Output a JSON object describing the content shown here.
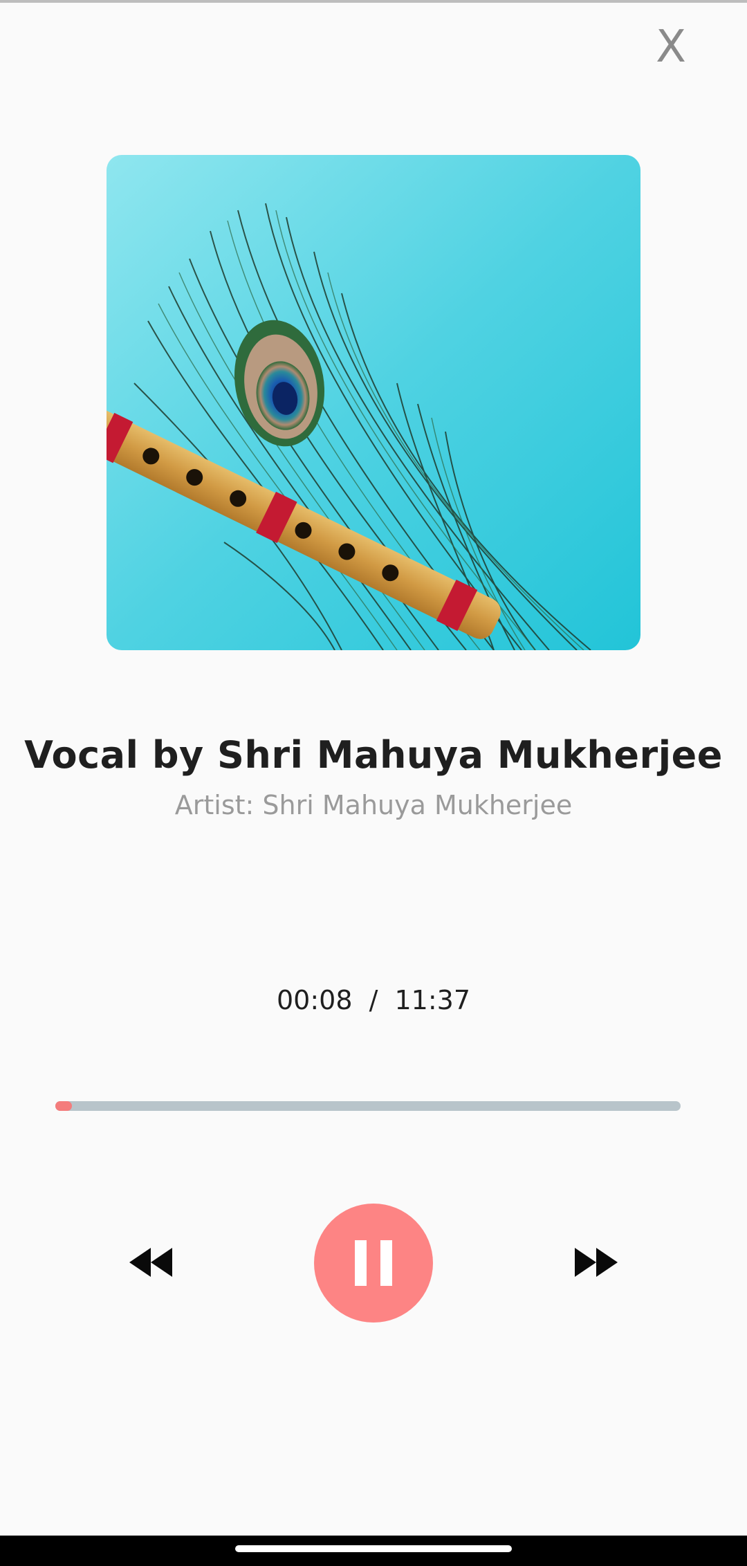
{
  "header": {
    "close_label": "X"
  },
  "track": {
    "title": "Vocal by Shri Mahuya Mukherjee",
    "artist": "Artist: Shri Mahuya Mukherjee"
  },
  "playback": {
    "elapsed": "00:08",
    "separator": "/",
    "duration": "11:37",
    "progress_fraction": 0.0115,
    "state": "playing"
  },
  "icons": {
    "close": "close-icon",
    "rewind": "rewind-icon",
    "pause": "pause-icon",
    "forward": "fast-forward-icon"
  },
  "colors": {
    "accent": "#fd8484",
    "progress_track": "#b8c4ca",
    "background": "#fafafa",
    "title": "#1f1f1f",
    "subtitle": "#9a9a9a"
  }
}
